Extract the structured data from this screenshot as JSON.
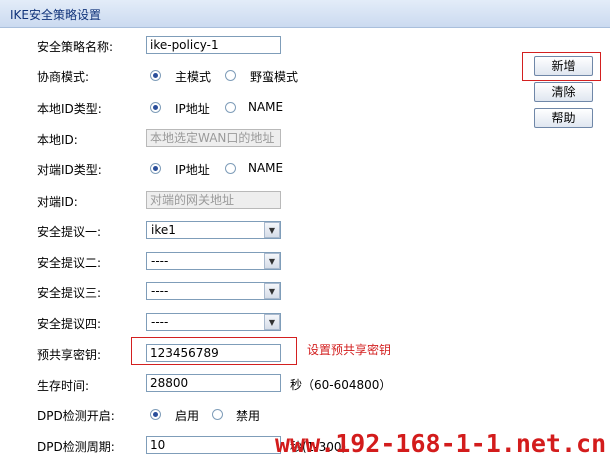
{
  "page": {
    "title": "IKE安全策略设置"
  },
  "form": {
    "policy_name_label": "安全策略名称:",
    "policy_name_value": "ike-policy-1",
    "mode_label": "协商模式:",
    "mode_options": [
      "主模式",
      "野蛮模式"
    ],
    "local_id_type_label": "本地ID类型:",
    "local_id_type_options": [
      "IP地址",
      "NAME"
    ],
    "local_id_label": "本地ID:",
    "local_id_value": "本地选定WAN口的地址",
    "remote_id_type_label": "对端ID类型:",
    "remote_id_type_options": [
      "IP地址",
      "NAME"
    ],
    "remote_id_label": "对端ID:",
    "remote_id_value": "对端的网关地址",
    "proposal1_label": "安全提议一:",
    "proposal1_value": "ike1",
    "proposal2_label": "安全提议二:",
    "proposal2_value": "----",
    "proposal3_label": "安全提议三:",
    "proposal3_value": "----",
    "proposal4_label": "安全提议四:",
    "proposal4_value": "----",
    "psk_label": "预共享密钥:",
    "psk_value": "123456789",
    "psk_hint": "设置预共享密钥",
    "lifetime_label": "生存时间:",
    "lifetime_value": "28800",
    "lifetime_unit": "秒（60-604800）",
    "dpd_enable_label": "DPD检测开启:",
    "dpd_enable_options": [
      "启用",
      "禁用"
    ],
    "dpd_period_label": "DPD检测周期:",
    "dpd_period_value": "10",
    "dpd_period_unit": "秒(1-300)"
  },
  "buttons": {
    "add": "新增",
    "clear": "清除",
    "help": "帮助"
  },
  "watermark": "www.192-168-1-1.net.cn",
  "colors": {
    "hint_red": "#d32020",
    "header_bg": "#cbdaf0",
    "header_text": "#10337a"
  }
}
